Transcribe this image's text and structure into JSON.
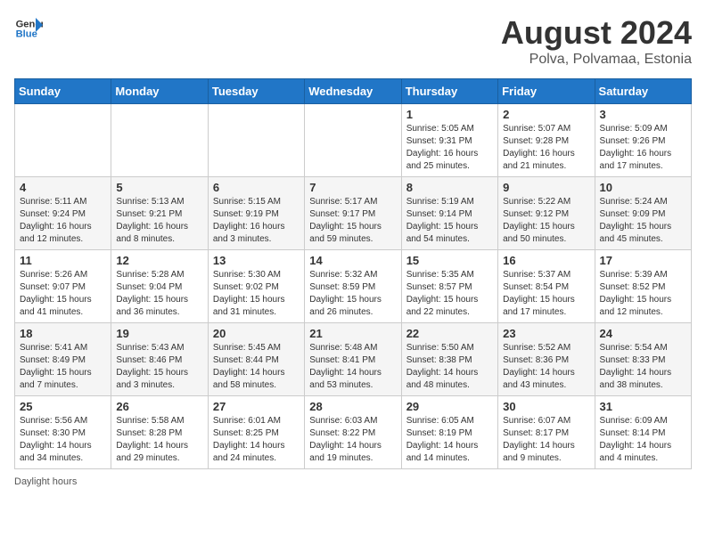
{
  "header": {
    "logo_general": "General",
    "logo_blue": "Blue",
    "title": "August 2024",
    "subtitle": "Polva, Polvamaa, Estonia"
  },
  "calendar": {
    "days_of_week": [
      "Sunday",
      "Monday",
      "Tuesday",
      "Wednesday",
      "Thursday",
      "Friday",
      "Saturday"
    ],
    "weeks": [
      [
        {
          "day": "",
          "info": ""
        },
        {
          "day": "",
          "info": ""
        },
        {
          "day": "",
          "info": ""
        },
        {
          "day": "",
          "info": ""
        },
        {
          "day": "1",
          "info": "Sunrise: 5:05 AM\nSunset: 9:31 PM\nDaylight: 16 hours and 25 minutes."
        },
        {
          "day": "2",
          "info": "Sunrise: 5:07 AM\nSunset: 9:28 PM\nDaylight: 16 hours and 21 minutes."
        },
        {
          "day": "3",
          "info": "Sunrise: 5:09 AM\nSunset: 9:26 PM\nDaylight: 16 hours and 17 minutes."
        }
      ],
      [
        {
          "day": "4",
          "info": "Sunrise: 5:11 AM\nSunset: 9:24 PM\nDaylight: 16 hours and 12 minutes."
        },
        {
          "day": "5",
          "info": "Sunrise: 5:13 AM\nSunset: 9:21 PM\nDaylight: 16 hours and 8 minutes."
        },
        {
          "day": "6",
          "info": "Sunrise: 5:15 AM\nSunset: 9:19 PM\nDaylight: 16 hours and 3 minutes."
        },
        {
          "day": "7",
          "info": "Sunrise: 5:17 AM\nSunset: 9:17 PM\nDaylight: 15 hours and 59 minutes."
        },
        {
          "day": "8",
          "info": "Sunrise: 5:19 AM\nSunset: 9:14 PM\nDaylight: 15 hours and 54 minutes."
        },
        {
          "day": "9",
          "info": "Sunrise: 5:22 AM\nSunset: 9:12 PM\nDaylight: 15 hours and 50 minutes."
        },
        {
          "day": "10",
          "info": "Sunrise: 5:24 AM\nSunset: 9:09 PM\nDaylight: 15 hours and 45 minutes."
        }
      ],
      [
        {
          "day": "11",
          "info": "Sunrise: 5:26 AM\nSunset: 9:07 PM\nDaylight: 15 hours and 41 minutes."
        },
        {
          "day": "12",
          "info": "Sunrise: 5:28 AM\nSunset: 9:04 PM\nDaylight: 15 hours and 36 minutes."
        },
        {
          "day": "13",
          "info": "Sunrise: 5:30 AM\nSunset: 9:02 PM\nDaylight: 15 hours and 31 minutes."
        },
        {
          "day": "14",
          "info": "Sunrise: 5:32 AM\nSunset: 8:59 PM\nDaylight: 15 hours and 26 minutes."
        },
        {
          "day": "15",
          "info": "Sunrise: 5:35 AM\nSunset: 8:57 PM\nDaylight: 15 hours and 22 minutes."
        },
        {
          "day": "16",
          "info": "Sunrise: 5:37 AM\nSunset: 8:54 PM\nDaylight: 15 hours and 17 minutes."
        },
        {
          "day": "17",
          "info": "Sunrise: 5:39 AM\nSunset: 8:52 PM\nDaylight: 15 hours and 12 minutes."
        }
      ],
      [
        {
          "day": "18",
          "info": "Sunrise: 5:41 AM\nSunset: 8:49 PM\nDaylight: 15 hours and 7 minutes."
        },
        {
          "day": "19",
          "info": "Sunrise: 5:43 AM\nSunset: 8:46 PM\nDaylight: 15 hours and 3 minutes."
        },
        {
          "day": "20",
          "info": "Sunrise: 5:45 AM\nSunset: 8:44 PM\nDaylight: 14 hours and 58 minutes."
        },
        {
          "day": "21",
          "info": "Sunrise: 5:48 AM\nSunset: 8:41 PM\nDaylight: 14 hours and 53 minutes."
        },
        {
          "day": "22",
          "info": "Sunrise: 5:50 AM\nSunset: 8:38 PM\nDaylight: 14 hours and 48 minutes."
        },
        {
          "day": "23",
          "info": "Sunrise: 5:52 AM\nSunset: 8:36 PM\nDaylight: 14 hours and 43 minutes."
        },
        {
          "day": "24",
          "info": "Sunrise: 5:54 AM\nSunset: 8:33 PM\nDaylight: 14 hours and 38 minutes."
        }
      ],
      [
        {
          "day": "25",
          "info": "Sunrise: 5:56 AM\nSunset: 8:30 PM\nDaylight: 14 hours and 34 minutes."
        },
        {
          "day": "26",
          "info": "Sunrise: 5:58 AM\nSunset: 8:28 PM\nDaylight: 14 hours and 29 minutes."
        },
        {
          "day": "27",
          "info": "Sunrise: 6:01 AM\nSunset: 8:25 PM\nDaylight: 14 hours and 24 minutes."
        },
        {
          "day": "28",
          "info": "Sunrise: 6:03 AM\nSunset: 8:22 PM\nDaylight: 14 hours and 19 minutes."
        },
        {
          "day": "29",
          "info": "Sunrise: 6:05 AM\nSunset: 8:19 PM\nDaylight: 14 hours and 14 minutes."
        },
        {
          "day": "30",
          "info": "Sunrise: 6:07 AM\nSunset: 8:17 PM\nDaylight: 14 hours and 9 minutes."
        },
        {
          "day": "31",
          "info": "Sunrise: 6:09 AM\nSunset: 8:14 PM\nDaylight: 14 hours and 4 minutes."
        }
      ]
    ]
  },
  "footer": {
    "note": "Daylight hours"
  }
}
